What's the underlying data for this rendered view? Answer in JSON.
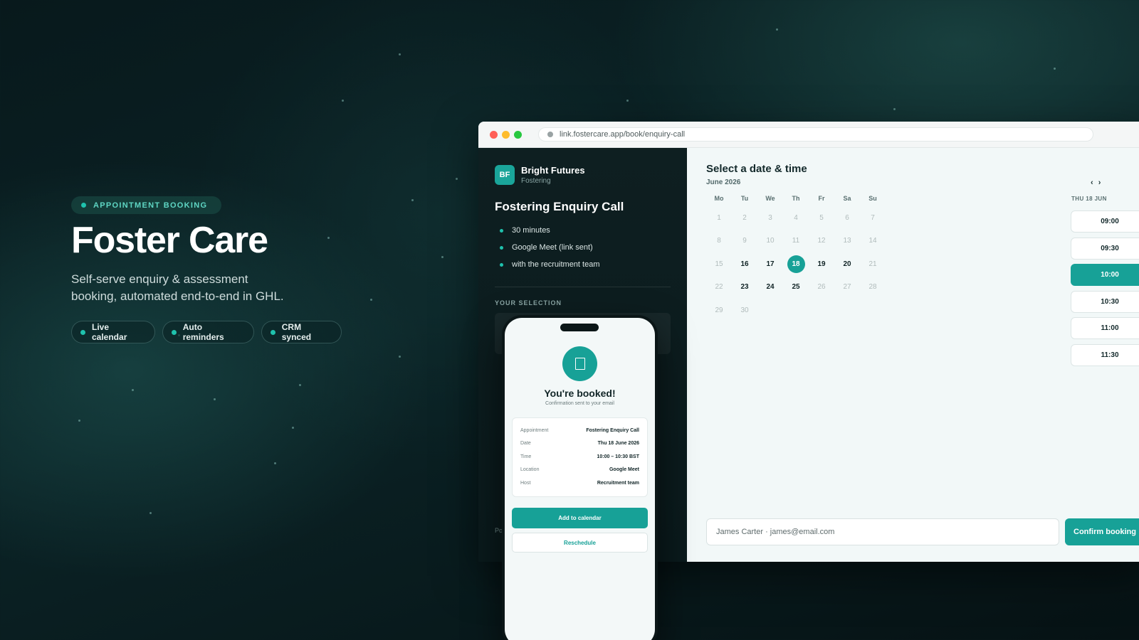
{
  "hero": {
    "tag": "APPOINTMENT BOOKING",
    "title": "Foster Care",
    "subtitle": "Self-serve enquiry & assessment booking, automated end-to-end in GHL.",
    "chips": [
      "Live calendar",
      "Auto reminders",
      "CRM synced"
    ]
  },
  "browser": {
    "url": "link.fostercare.app/book/enquiry-call"
  },
  "sidebar": {
    "logo": "BF",
    "org_name": "Bright Futures",
    "org_sub": "Fostering",
    "event_title": "Fostering Enquiry Call",
    "details": [
      "30 minutes",
      "Google Meet (link sent)",
      "with the recruitment team"
    ],
    "selection_label": "YOUR SELECTION",
    "powered": "Po"
  },
  "calendar": {
    "title": "Select a date & time",
    "month": "June 2026",
    "nav": "‹ ›",
    "weekdays": [
      "Mo",
      "Tu",
      "We",
      "Th",
      "Fr",
      "Sa",
      "Su"
    ],
    "days": [
      "1",
      "2",
      "3",
      "4",
      "5",
      "6",
      "7",
      "8",
      "9",
      "10",
      "11",
      "12",
      "13",
      "14",
      "15",
      "16",
      "17",
      "18",
      "19",
      "20",
      "21",
      "22",
      "23",
      "24",
      "25",
      "26",
      "27",
      "28",
      "29",
      "30"
    ],
    "available_days": [
      "16",
      "17",
      "18",
      "19",
      "20",
      "23",
      "24",
      "25"
    ],
    "selected_day": "18",
    "slot_heading": "THU 18 JUN",
    "slots": [
      "09:00",
      "09:30",
      "10:00",
      "10:30",
      "11:00",
      "11:30"
    ],
    "selected_slot": "10:00",
    "contact_value": "James Carter · james@email.com",
    "confirm_label": "Confirm booking"
  },
  "phone": {
    "title": "You're booked!",
    "subtitle": "Confirmation sent to your email",
    "rows": [
      {
        "label": "Appointment",
        "value": "Fostering Enquiry Call"
      },
      {
        "label": "Date",
        "value": "Thu 18 June 2026"
      },
      {
        "label": "Time",
        "value": "10:00 – 10:30 BST"
      },
      {
        "label": "Location",
        "value": "Google Meet"
      },
      {
        "label": "Host",
        "value": "Recruitment team"
      }
    ],
    "primary_button": "Add to calendar",
    "secondary_button": "Reschedule"
  },
  "colors": {
    "accent": "#17a197",
    "background": "#0b2326",
    "close_light": "#ff5f57",
    "min_light": "#febc2e",
    "max_light": "#28c840"
  },
  "icons": [
    "calendar-icon",
    "lock-icon"
  ]
}
